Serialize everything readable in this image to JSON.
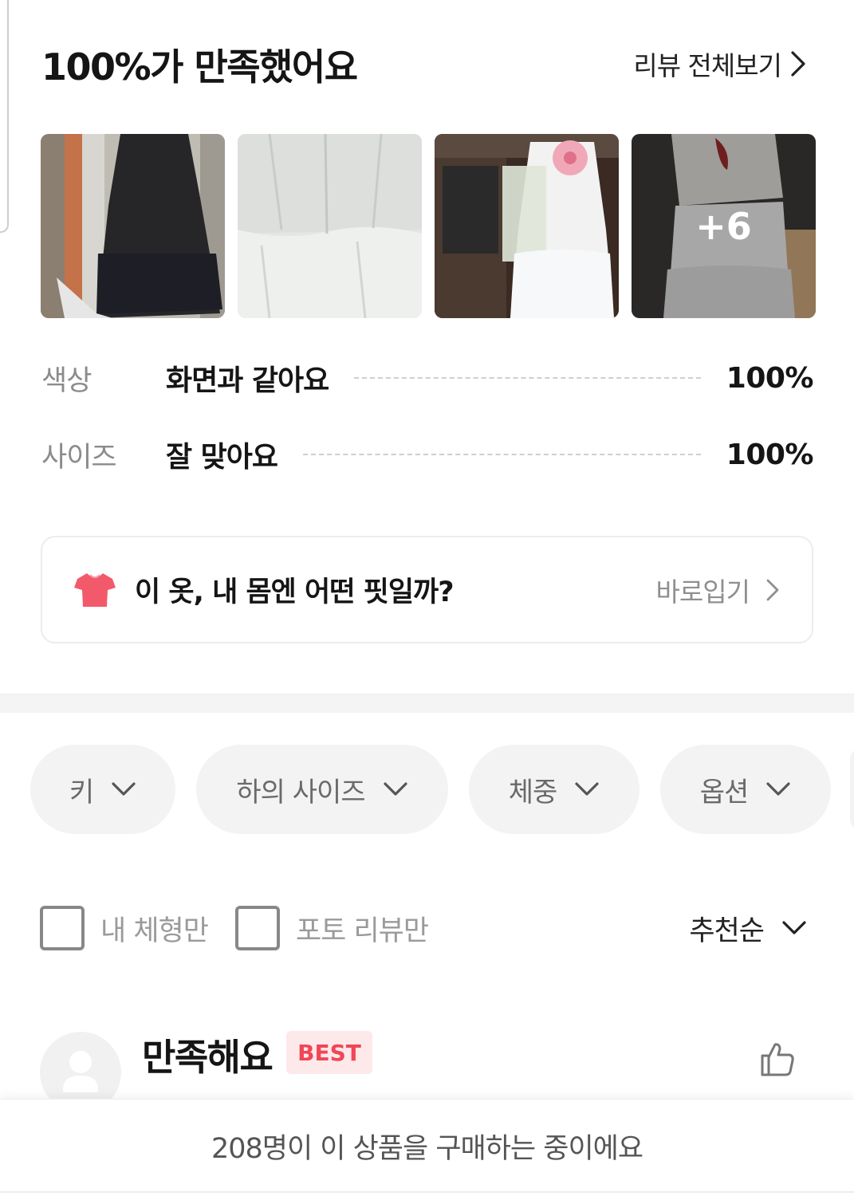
{
  "header": {
    "title": "100%가 만족했어요",
    "more_label": "리뷰 전체보기"
  },
  "photos": {
    "more_count": "+6",
    "items": [
      {
        "icon": "review-photo-black-dress"
      },
      {
        "icon": "review-photo-white-skirt"
      },
      {
        "icon": "review-photo-person-flowers"
      },
      {
        "icon": "review-photo-person-skirt"
      }
    ]
  },
  "ratings": [
    {
      "label": "색상",
      "value": "화면과 같아요",
      "percent": "100%"
    },
    {
      "label": "사이즈",
      "value": "잘 맞아요",
      "percent": "100%"
    }
  ],
  "fit_check": {
    "icon": "tshirt-icon",
    "text": "이 옷, 내 몸엔 어떤 핏일까?",
    "link_label": "바로입기"
  },
  "filter_chips": [
    {
      "label": "키"
    },
    {
      "label": "하의 사이즈"
    },
    {
      "label": "체중"
    },
    {
      "label": "옵션"
    }
  ],
  "filters": {
    "my_body_only": "내 체형만",
    "photo_only": "포토 리뷰만",
    "sort_label": "추천순"
  },
  "review": {
    "title": "만족해요",
    "badge": "BEST"
  },
  "bottom_bar": {
    "text": "208명이 이 상품을 구매하는 중이에요"
  },
  "colors": {
    "accent_pink": "#f04658",
    "badge_bg": "#fde8ea",
    "chip_bg": "#f3f3f3",
    "shirt_icon": "#f25a6c"
  }
}
